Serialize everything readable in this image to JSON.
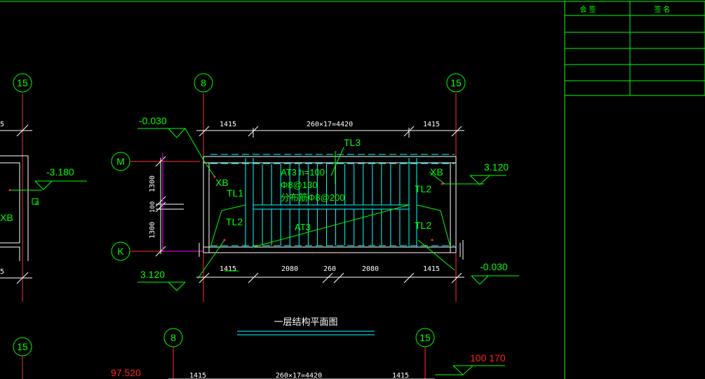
{
  "colors": {
    "background": "#000000",
    "axis_line": "#ff3030",
    "grid_bubble": "#00ff00",
    "structure": "#00ff00",
    "dimension": "#ffffff",
    "wall": "#ffffff",
    "stair_tread": "#00ffff",
    "level_text": "#00ff00",
    "annotation": "#00ff00",
    "magenta": "#ff00ff",
    "red_text": "#ff2020"
  },
  "title_block": {
    "header_col1": "会 签",
    "header_col2": "签 名",
    "blank_rows": 4
  },
  "grid_bubbles": {
    "top_left": "15",
    "top_8": "8",
    "top_15": "15",
    "row_m": "M",
    "row_k": "K",
    "bottom_left": "15",
    "bottom_8": "8",
    "bottom_15": "15"
  },
  "levels": {
    "top_left_level": "-0.030",
    "left_partial_level": "-3.180",
    "right_level": "3.120",
    "bottom_left_level": "3.120",
    "bottom_right_level": "-0.030",
    "red_level": "97.520",
    "bottom_right_red": "100 170"
  },
  "dimensions": {
    "top": [
      "1415",
      "260×17=4420",
      "1415"
    ],
    "bottom": [
      "1415",
      "2080",
      "260",
      "2080",
      "1415"
    ],
    "left_vertical": [
      "1300",
      "100",
      "1300"
    ],
    "lower_top": [
      "1415",
      "260×17=4420",
      "1415"
    ]
  },
  "labels": {
    "tl3": "TL3",
    "tl1": "TL1",
    "tl2_left": "TL2",
    "tl2_right_top": "TL2",
    "tl2_right_bottom": "TL2",
    "xb_left": "XB",
    "xb_right": "XB",
    "xb_partial": "XB",
    "at3_top": "AT3 h=100",
    "rebar1": "Φ8@130",
    "rebar2": "分布筋Φ8@200",
    "at3_diag": "AT3",
    "partial_left_a": "a"
  },
  "drawing_title": "一层结构平面图"
}
